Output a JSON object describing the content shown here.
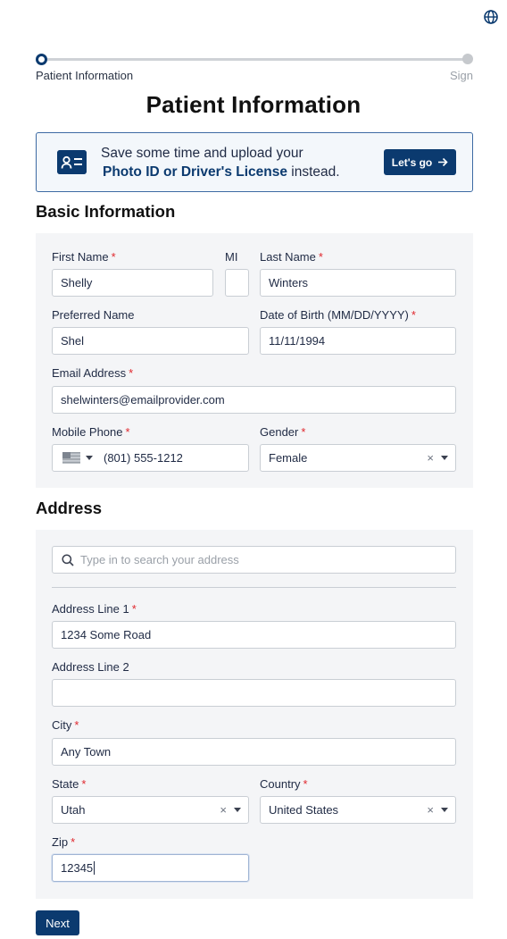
{
  "progress": {
    "current_step": "Patient Information",
    "final_step": "Sign"
  },
  "page_title": "Patient Information",
  "banner": {
    "line1": "Save some time and upload your",
    "link_text": "Photo ID or Driver's License",
    "line2_suffix": "instead.",
    "button_label": "Let's go"
  },
  "basic_info": {
    "heading": "Basic Information",
    "first_name": {
      "label": "First Name",
      "value": "Shelly"
    },
    "mi": {
      "label": "MI",
      "value": ""
    },
    "last_name": {
      "label": "Last Name",
      "value": "Winters"
    },
    "preferred_name": {
      "label": "Preferred Name",
      "value": "Shel"
    },
    "dob": {
      "label": "Date of Birth (MM/DD/YYYY)",
      "value": "11/11/1994"
    },
    "email": {
      "label": "Email Address",
      "value": "shelwinters@emailprovider.com"
    },
    "mobile": {
      "label": "Mobile Phone",
      "value": "(801) 555-1212"
    },
    "gender": {
      "label": "Gender",
      "value": "Female"
    }
  },
  "address": {
    "heading": "Address",
    "search_placeholder": "Type in to search your address",
    "line1": {
      "label": "Address Line 1",
      "value": "1234 Some Road"
    },
    "line2": {
      "label": "Address Line 2",
      "value": ""
    },
    "city": {
      "label": "City",
      "value": "Any Town"
    },
    "state": {
      "label": "State",
      "value": "Utah"
    },
    "country": {
      "label": "Country",
      "value": "United States"
    },
    "zip": {
      "label": "Zip",
      "value": "12345"
    }
  },
  "required_mark": "*",
  "clear_glyph": "×",
  "next_label": "Next",
  "colors": {
    "primary": "#0b3a6f",
    "required": "#e0282e",
    "panel_bg": "#f4f5f7"
  },
  "icons": [
    "globe-icon",
    "id-card-icon",
    "arrow-right-icon",
    "search-icon",
    "us-flag-icon",
    "clear-icon",
    "chevron-down-icon"
  ]
}
